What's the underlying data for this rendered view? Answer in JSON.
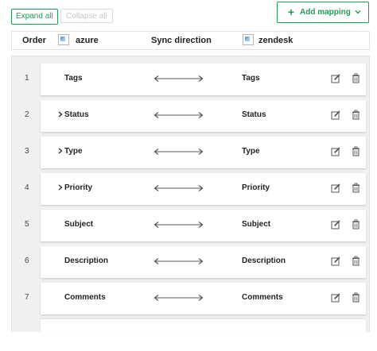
{
  "toolbar": {
    "expand_all_label": "Expand all",
    "collapse_all_label": "Collapse all",
    "add_mapping_label": "Add mapping",
    "add_icon": "plus-icon",
    "dropdown_icon": "chevron-down-icon"
  },
  "header": {
    "order": "Order",
    "left_system": "azure",
    "sync_direction": "Sync direction",
    "right_system": "zendesk"
  },
  "mappings": [
    {
      "order": "1",
      "left": "Tags",
      "right": "Tags",
      "expandable": false
    },
    {
      "order": "2",
      "left": "Status",
      "right": "Status",
      "expandable": true
    },
    {
      "order": "3",
      "left": "Type",
      "right": "Type",
      "expandable": true
    },
    {
      "order": "4",
      "left": "Priority",
      "right": "Priority",
      "expandable": true
    },
    {
      "order": "5",
      "left": "Subject",
      "right": "Subject",
      "expandable": false
    },
    {
      "order": "6",
      "left": "Description",
      "right": "Description",
      "expandable": false
    },
    {
      "order": "7",
      "left": "Comments",
      "right": "Comments",
      "expandable": false
    }
  ],
  "colors": {
    "accent": "#1f9d55",
    "panel_bg": "#f0f0f0",
    "icon_gray": "#555555"
  }
}
